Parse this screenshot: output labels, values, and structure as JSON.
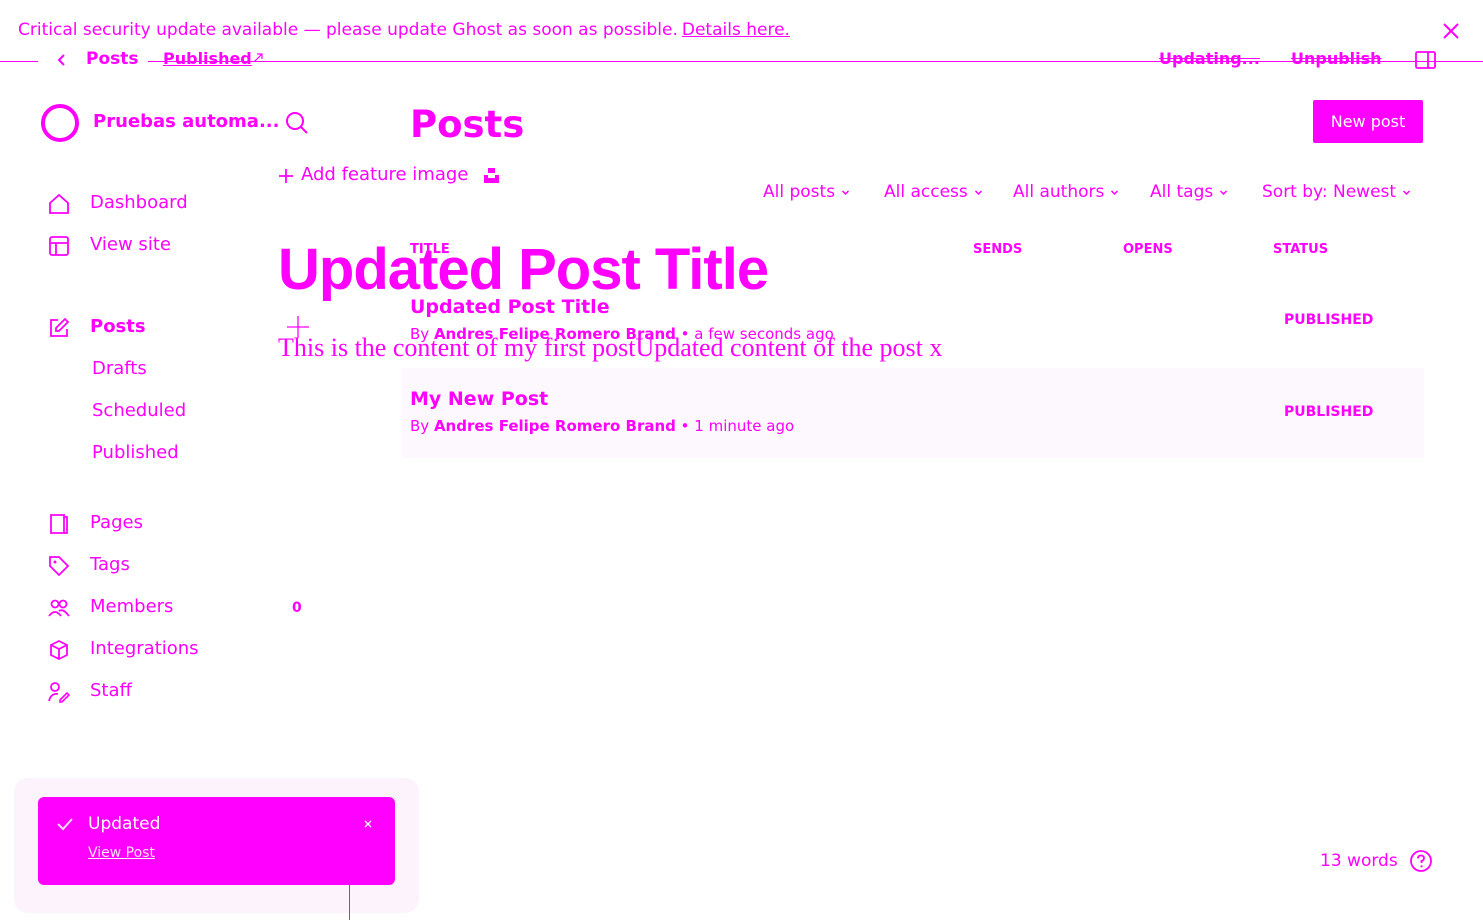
{
  "banner": {
    "message": "Critical security update available — please update Ghost as soon as possible.",
    "link_text": "Details here."
  },
  "editor_header": {
    "back_label": "Posts",
    "status_label": "Published",
    "saving_label": "Updating...",
    "unpublish_label": "Unpublish"
  },
  "sidebar": {
    "site_name": "Pruebas automa...",
    "items": [
      {
        "label": "Dashboard",
        "icon": "home-icon"
      },
      {
        "label": "View site",
        "icon": "layout-icon"
      },
      {
        "label": "Posts",
        "icon": "pencil-square-icon"
      },
      {
        "label": "Drafts"
      },
      {
        "label": "Scheduled"
      },
      {
        "label": "Published"
      },
      {
        "label": "Pages",
        "icon": "page-icon"
      },
      {
        "label": "Tags",
        "icon": "tag-icon"
      },
      {
        "label": "Members",
        "icon": "members-icon",
        "count": "0"
      },
      {
        "label": "Integrations",
        "icon": "cube-icon"
      },
      {
        "label": "Staff",
        "icon": "staff-icon"
      }
    ]
  },
  "main": {
    "title": "Posts",
    "new_post_label": "New post",
    "filters": [
      "All posts",
      "All access",
      "All authors",
      "All tags",
      "Sort by: Newest"
    ],
    "columns": [
      "TITLE",
      "SENDS",
      "OPENS",
      "STATUS"
    ],
    "posts": [
      {
        "title": "Updated Post Title",
        "by": "By",
        "author": "Andres Felipe Romero Brand",
        "time": "• a few seconds ago",
        "status": "PUBLISHED"
      },
      {
        "title": "My New Post",
        "by": "By",
        "author": "Andres Felipe Romero Brand",
        "time": "• 1 minute ago",
        "status": "PUBLISHED"
      }
    ]
  },
  "editor": {
    "add_feature_image": "Add feature image",
    "post_title": "Updated Post Title",
    "content": "This is the content of my first postUpdated content of the post x",
    "word_count": "13 words"
  },
  "toast": {
    "message": "Updated",
    "link_text": "View Post"
  },
  "colors": {
    "accent": "#ff00ff",
    "background": "#ffffff"
  }
}
